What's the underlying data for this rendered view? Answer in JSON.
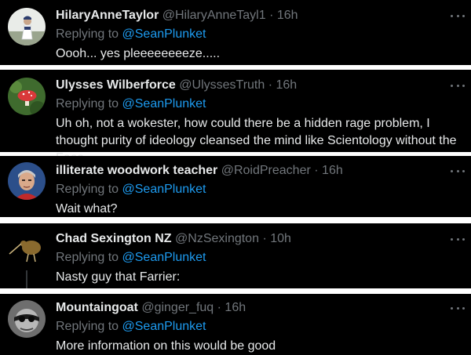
{
  "replies": [
    {
      "name": "HilaryAnneTaylor",
      "handle": "@HilaryAnneTayl1",
      "sep": "·",
      "time": "16h",
      "replying_prefix": "Replying to ",
      "replying_to": "@SeanPlunket",
      "text": "Oooh... yes pleeeeeeeeze.....",
      "avatar_icon": "person-photo"
    },
    {
      "name": "Ulysses Wilberforce",
      "handle": "@UlyssesTruth",
      "sep": "·",
      "time": "16h",
      "replying_prefix": "Replying to ",
      "replying_to": "@SeanPlunket",
      "text": "Uh oh, not a wokester, how could there be a hidden rage problem, I thought purity of ideology cleansed the mind like Scientology without the Fees",
      "avatar_icon": "mushroom-photo"
    },
    {
      "name": "illiterate woodwork teacher",
      "handle": "@RoidPreacher",
      "sep": "·",
      "time": "16h",
      "replying_prefix": "Replying to ",
      "replying_to": "@SeanPlunket",
      "text": "Wait what?",
      "avatar_icon": "man-portrait-photo"
    },
    {
      "name": "Chad Sexington NZ",
      "handle": "@NzSexington",
      "sep": "·",
      "time": "10h",
      "replying_prefix": "Replying to ",
      "replying_to": "@SeanPlunket",
      "text": "Nasty guy that Farrier:",
      "avatar_icon": "kiwi-bird"
    },
    {
      "name": "Mountaingoat",
      "handle": "@ginger_fuq",
      "sep": "·",
      "time": "16h",
      "replying_prefix": "Replying to ",
      "replying_to": "@SeanPlunket",
      "text": "More information on this would be good",
      "avatar_icon": "masked-face-photo"
    }
  ],
  "colors": {
    "background": "#000000",
    "separator": "#ffffff",
    "name": "#e7e9ea",
    "meta": "#71767b",
    "mention": "#1d9bf0"
  }
}
